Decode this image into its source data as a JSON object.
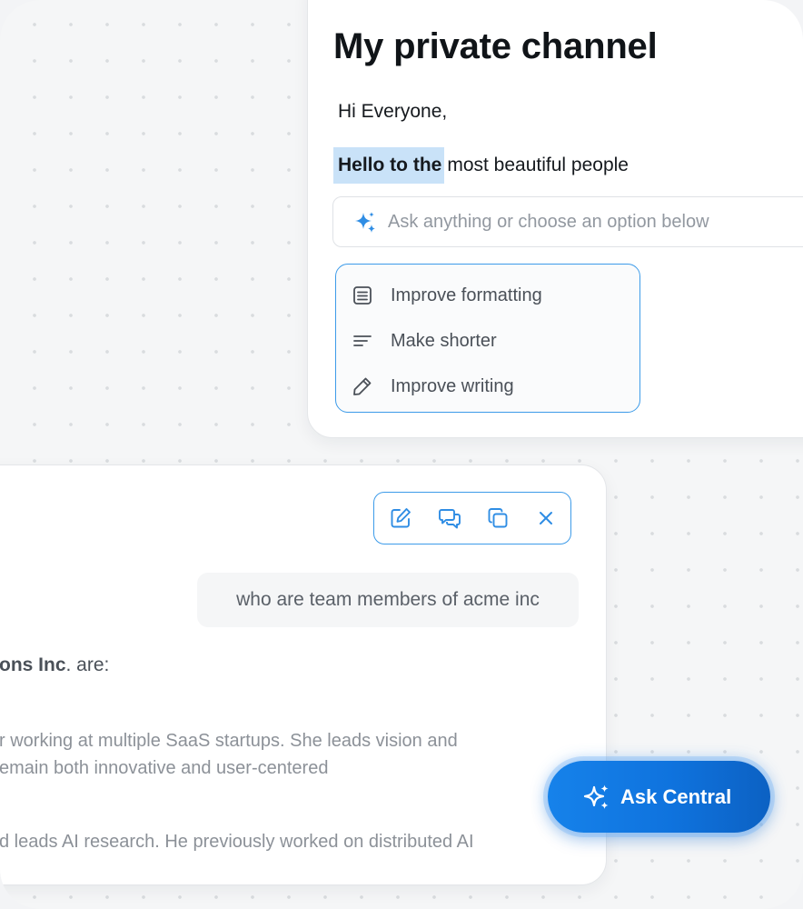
{
  "editor": {
    "title": "My private channel",
    "greeting": "Hi Everyone,",
    "line_highlight": "Hello to the",
    "line_rest": "most beautiful people",
    "ask_placeholder": "Ask anything or choose an option below",
    "options": [
      {
        "label": "Improve formatting",
        "icon": "document-lines-icon"
      },
      {
        "label": "Make shorter",
        "icon": "short-lines-icon"
      },
      {
        "label": "Improve writing",
        "icon": "pencil-icon"
      }
    ]
  },
  "chat": {
    "toolbar": {
      "buttons": [
        "edit-icon",
        "chat-bubbles-icon",
        "copy-icon",
        "close-icon"
      ]
    },
    "user_message": "who are team members of acme inc",
    "answer_intro_bold": "ons Inc",
    "answer_intro_rest": ". are:",
    "paragraphs": [
      {
        "lines": [
          "r working at multiple SaaS startups.  She leads vision and",
          "emain both innovative and user-centered"
        ]
      },
      {
        "lines": [
          "d leads AI research.  He previously worked on distributed AI"
        ]
      }
    ]
  },
  "ask_central": {
    "label": "Ask Central"
  },
  "colors": {
    "accent": "#3d9be9",
    "button_blue": "#0f73de",
    "highlight": "#c9e2f8",
    "background": "#f5f6f7"
  }
}
